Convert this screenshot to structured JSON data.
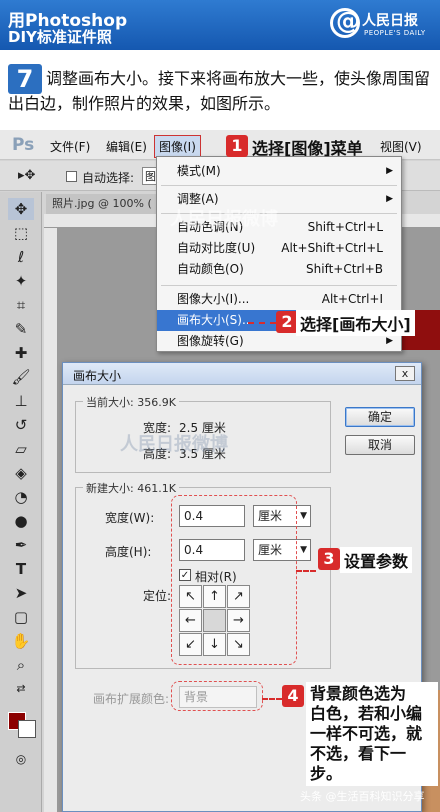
{
  "banner": {
    "title_line1": "用Photoshop",
    "title_line2": "DIY标准证件照",
    "brand": "人民日报",
    "brand_sub": "PEOPLE'S DAILY"
  },
  "step": {
    "number": "7",
    "text": "调整画布大小。接下来将画布放大一些，使头像周围留出白边，制作照片的效果，如图所示。"
  },
  "photoshop": {
    "logo": "Ps",
    "menus": [
      "文件(F)",
      "编辑(E)",
      "图像(I)",
      "视图(V)"
    ],
    "options": {
      "auto_select_label": "自动选择:",
      "auto_select_value": "图"
    },
    "doc_tab": "照片.jpg @ 100% (",
    "image_menu": {
      "items": [
        {
          "label": "模式(M)",
          "shortcut": "",
          "submenu": true
        },
        {
          "label": "调整(A)",
          "shortcut": "",
          "submenu": true
        },
        {
          "label": "自动色调(N)",
          "shortcut": "Shift+Ctrl+L",
          "submenu": false
        },
        {
          "label": "自动对比度(U)",
          "shortcut": "Alt+Shift+Ctrl+L",
          "submenu": false
        },
        {
          "label": "自动颜色(O)",
          "shortcut": "Shift+Ctrl+B",
          "submenu": false
        },
        {
          "label": "图像大小(I)...",
          "shortcut": "Alt+Ctrl+I",
          "submenu": false
        },
        {
          "label": "画布大小(S)...",
          "shortcut": "",
          "submenu": false
        },
        {
          "label": "图像旋转(G)",
          "shortcut": "",
          "submenu": true
        }
      ]
    }
  },
  "dialog": {
    "title": "画布大小",
    "close": "x",
    "current_size_label": "当前大小: 356.9K",
    "current_width_label": "宽度:",
    "current_width_value": "2.5 厘米",
    "current_height_label": "高度:",
    "current_height_value": "3.5 厘米",
    "new_size_label": "新建大小: 461.1K",
    "width_label": "宽度(W):",
    "width_value": "0.4",
    "width_unit": "厘米",
    "height_label": "高度(H):",
    "height_value": "0.4",
    "height_unit": "厘米",
    "relative_label": "相对(R)",
    "anchor_label": "定位:",
    "ext_color_label": "画布扩展颜色:",
    "ext_color_value": "背景",
    "ok": "确定",
    "cancel": "取消"
  },
  "callouts": {
    "c1_num": "1",
    "c1_text": "选择[图像]菜单",
    "c2_num": "2",
    "c2_text": "选择[画布大小]",
    "c3_num": "3",
    "c3_text": "设置参数",
    "c4_num": "4",
    "c4_lines": [
      "背景颜色选为",
      "白色，若和小编",
      "一样不可选，就",
      "不选，看下一步。"
    ]
  },
  "watermark": "人民日报微博",
  "footer": "头条 @生活百科知识分享",
  "colors": {
    "banner": "#1f69c3",
    "highlight": "#3876d0",
    "callout_red": "#d82b2b",
    "foreground_swatch": "#8b0000"
  }
}
